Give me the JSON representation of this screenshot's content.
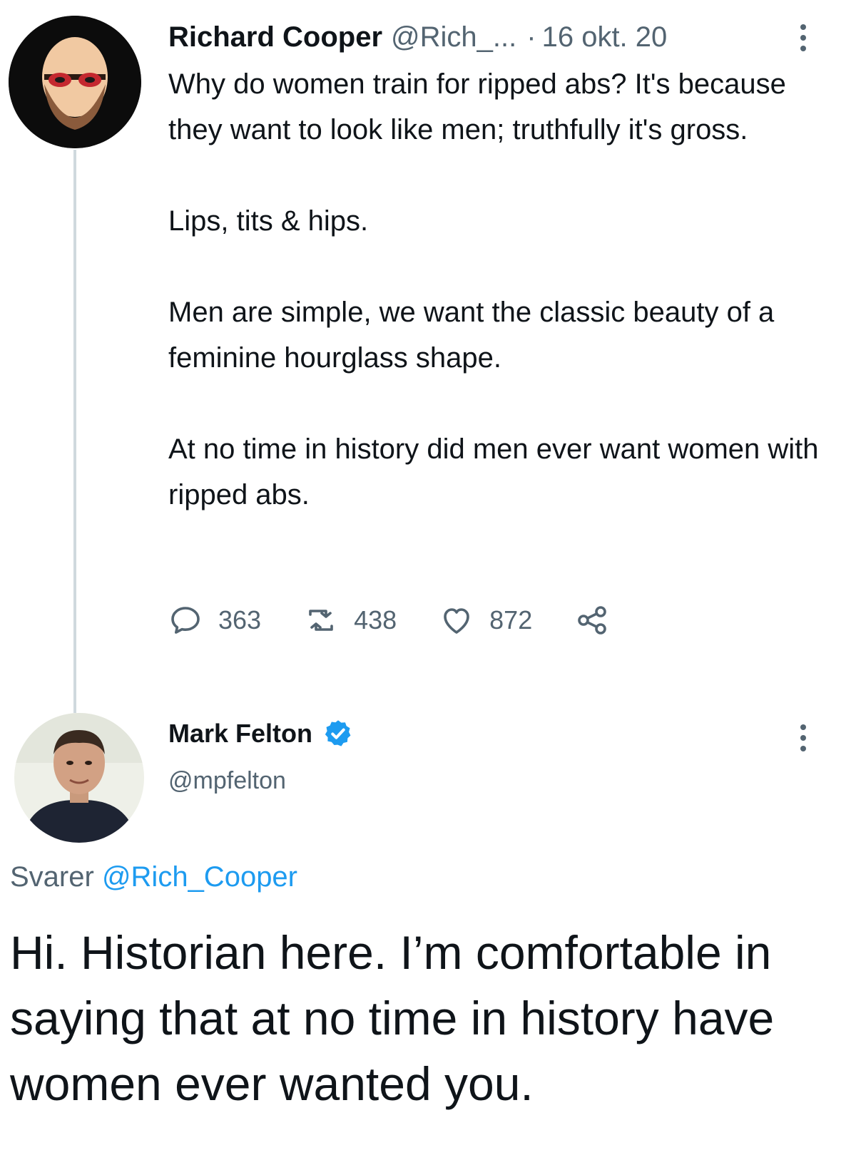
{
  "original_tweet": {
    "author_name": "Richard Cooper",
    "handle": "@Rich_...",
    "separator": "·",
    "date": "16 okt. 20",
    "paragraphs": [
      "Why do women train for ripped abs? It's because they want to look like men; truthfully it's gross.",
      "Lips, tits & hips.",
      "Men are simple, we want the classic beauty of a feminine hourglass shape.",
      "At no time in history did men ever want women with ripped abs."
    ],
    "actions": {
      "replies": "363",
      "retweets": "438",
      "likes": "872"
    },
    "colors": {
      "text": "#0f1419",
      "secondary": "#536471"
    }
  },
  "reply_tweet": {
    "author_name": "Mark Felton",
    "handle": "@mpfelton",
    "verified": true,
    "replying_label": "Svarer",
    "replying_to": "@Rich_Cooper",
    "body": "Hi. Historian here. I’m comfortable in saying that at no time in history have women ever wanted you.",
    "colors": {
      "verified_badge": "#1d9bf0",
      "mention": "#1d9bf0"
    }
  },
  "icons": {
    "reply": "reply-icon",
    "retweet": "retweet-icon",
    "like": "heart-icon",
    "share": "share-icon",
    "more": "more-options-icon",
    "verified": "verified-badge-icon"
  }
}
